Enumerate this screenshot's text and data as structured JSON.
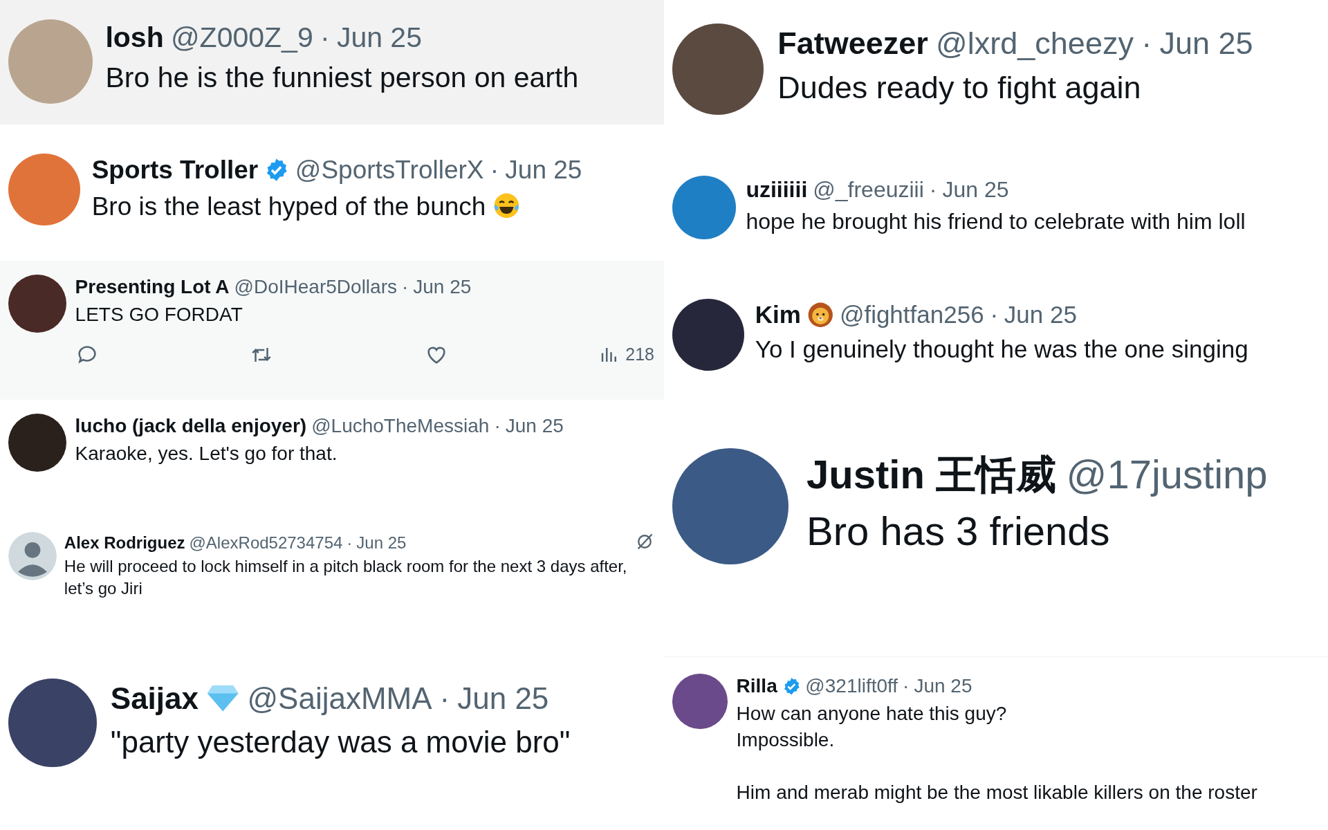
{
  "columns": [
    {
      "tweets": [
        {
          "name": "losh",
          "handle": "@Z000Z_9",
          "sep": "·",
          "date": "Jun 25",
          "text": "Bro he is the funniest person on earth",
          "avatar": {
            "kind": "photo"
          }
        },
        {
          "name": "Sports Troller",
          "badge": {
            "kind": "verified"
          },
          "handle": "@SportsTrollerX",
          "sep": "·",
          "date": "Jun 25",
          "text": "Bro is the least hyped of the bunch",
          "emoji": {
            "kind": "tears_of_joy"
          },
          "avatar": {
            "kind": "photo"
          }
        },
        {
          "name": "Presenting Lot A",
          "handle": "@DoIHear5Dollars",
          "sep": "·",
          "date": "Jun 25",
          "text": "LETS GO FORDAT",
          "avatar": {
            "kind": "photo"
          },
          "views": "218"
        },
        {
          "name": "lucho (jack della enjoyer)",
          "handle": "@LuchoTheMessiah",
          "sep": "·",
          "date": "Jun 25",
          "text": "Karaoke, yes. Let's go for that.",
          "avatar": {
            "kind": "photo"
          }
        },
        {
          "name": "Alex Rodriguez",
          "handle": "@AlexRod52734754",
          "sep": "·",
          "date": "Jun 25",
          "text": "He will proceed to lock himself in a pitch black room for the next 3 days after, let’s go Jiri",
          "avatar": {
            "kind": "default"
          },
          "corner_icon": {
            "kind": "slashed_circle"
          }
        },
        {
          "name": "Saijax",
          "badge": {
            "kind": "diamond"
          },
          "handle": "@SaijaxMMA",
          "sep": "·",
          "date": "Jun 25",
          "text": "\"party yesterday was a movie bro\"",
          "avatar": {
            "kind": "photo"
          }
        }
      ]
    },
    {
      "tweets": [
        {
          "name": "Fatweezer",
          "handle": "@lxrd_cheezy",
          "sep": "·",
          "date": "Jun 25",
          "text": "Dudes ready to fight again",
          "avatar": {
            "kind": "photo"
          }
        },
        {
          "name": "uziiiiii",
          "handle": "@_freeuziii",
          "sep": "·",
          "date": "Jun 25",
          "text": "hope he brought his friend to celebrate with him loll",
          "avatar": {
            "kind": "photo"
          }
        },
        {
          "name": "Kim",
          "badge": {
            "kind": "lion"
          },
          "handle": "@fightfan256",
          "sep": "·",
          "date": "Jun 25",
          "text": "Yo I genuinely thought he was the one singing",
          "avatar": {
            "kind": "photo"
          }
        },
        {
          "name": "Justin 王恬威",
          "handle": "@17justinp",
          "text": "Bro has 3 friends",
          "avatar": {
            "kind": "photo"
          }
        },
        {
          "name": "Rilla",
          "badge": {
            "kind": "verified"
          },
          "handle": "@321lift0ff",
          "sep": "·",
          "date": "Jun 25",
          "text": "How can anyone hate this guy?\nImpossible.\n\nHim and merab might be the most likable killers on the roster",
          "avatar": {
            "kind": "photo"
          }
        }
      ]
    }
  ]
}
